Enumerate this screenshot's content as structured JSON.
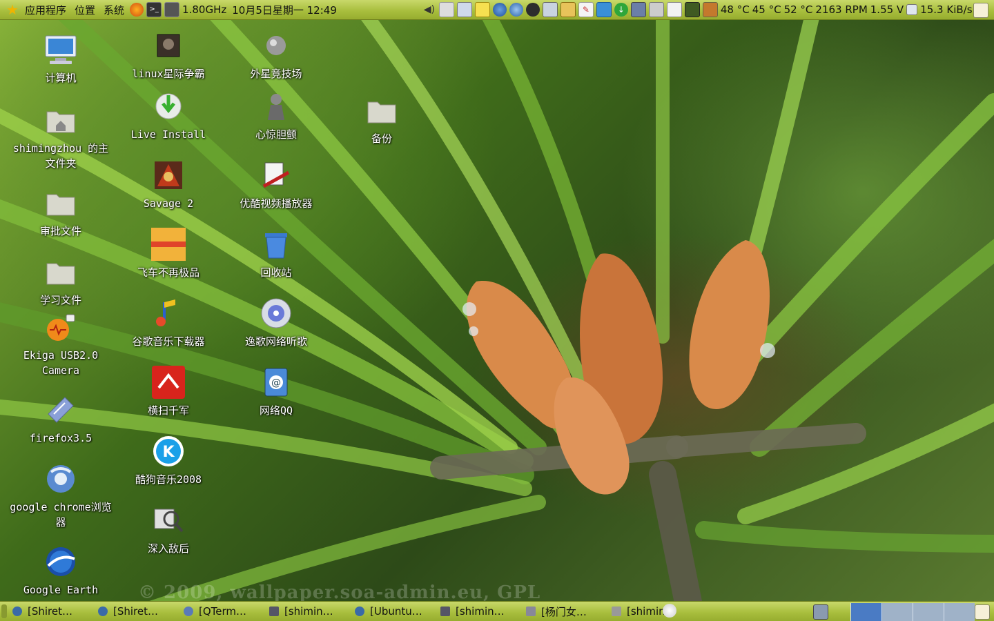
{
  "top_panel": {
    "menus": [
      "应用程序",
      "位置",
      "系统"
    ],
    "cpu_freq": "1.80GHz",
    "clock": "10月5日星期一 12:49",
    "temp1": "48 °C",
    "temp2": "45 °C",
    "temp3": "52 °C",
    "fan": "2163 RPM",
    "voltage": "1.55 V",
    "net_speed": "15.3 KiB/s"
  },
  "desktop_icons": {
    "computer": "计算机",
    "home_folder": "shimingzhou 的主文件夹",
    "approval_files": "审批文件",
    "study_files": "学习文件",
    "ekiga": "Ekiga USB2.0 Camera",
    "firefox": "firefox3.5",
    "chrome": "google chrome浏览器",
    "google_earth": "Google Earth",
    "starcraft": "linux星际争霸",
    "live_install": "Live Install",
    "savage": "Savage 2",
    "need_for_speed": "飞车不再极品",
    "google_music": "谷歌音乐下载器",
    "hengsao": "横扫千军",
    "kugou": "酷狗音乐2008",
    "behind_enemy": "深入敌后",
    "arena": "外星竞技场",
    "heart_stop": "心惊胆颤",
    "youku": "优酷视频播放器",
    "trash": "回收站",
    "yige": "逸歌网络听歌",
    "webqq": "网络QQ",
    "backup": "备份"
  },
  "wallpaper": {
    "watermark": "© 2009, wallpaper.soa-admin.eu, GPL"
  },
  "taskbar": {
    "tasks": [
      "[Shiret…",
      "[Shiret…",
      "[QTerm…",
      "[shimin…",
      "[Ubuntu…",
      "[shimin…",
      "[杨门女…",
      "[shimin…"
    ]
  },
  "colors": {
    "panel": "#a9bf3e",
    "workspace_active": "#4a7bc4",
    "workspace_inactive": "#9fb2c8"
  }
}
